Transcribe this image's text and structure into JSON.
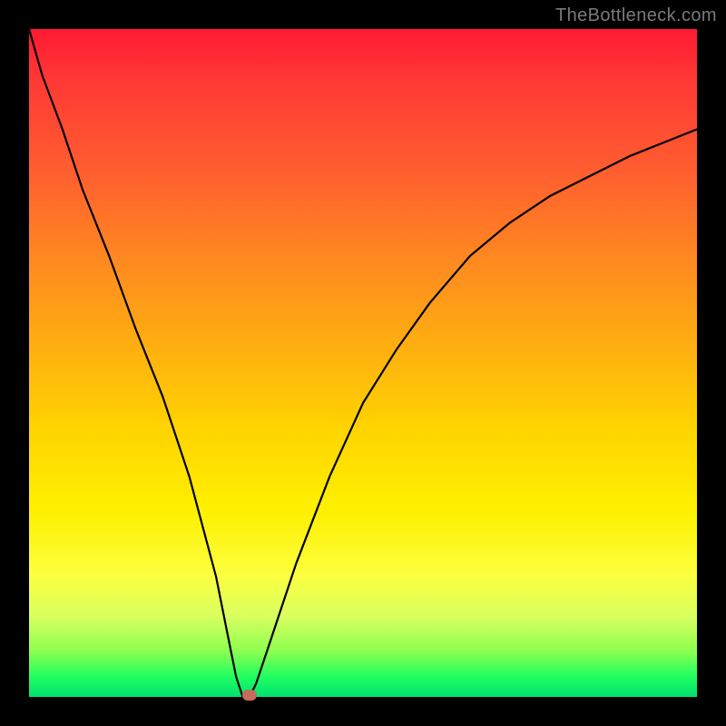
{
  "watermark": "TheBottleneck.com",
  "colors": {
    "accent_marker": "#c86b5a",
    "curve": "#000000"
  },
  "chart_data": {
    "type": "line",
    "title": "",
    "xlabel": "",
    "ylabel": "",
    "xlim": [
      0,
      100
    ],
    "ylim": [
      0,
      100
    ],
    "grid": false,
    "annotations": [],
    "series": [
      {
        "name": "curve",
        "x": [
          0,
          2,
          5,
          8,
          12,
          16,
          20,
          24,
          28,
          30,
          31,
          32,
          33,
          34,
          36,
          40,
          45,
          50,
          55,
          60,
          66,
          72,
          78,
          84,
          90,
          95,
          100
        ],
        "values": [
          100,
          93,
          85,
          76,
          66,
          55,
          45,
          33,
          18,
          8,
          3,
          0,
          0,
          2,
          8,
          20,
          33,
          44,
          52,
          59,
          66,
          71,
          75,
          78,
          81,
          83,
          85
        ]
      }
    ],
    "marker": {
      "x": 33,
      "y": 0
    }
  }
}
